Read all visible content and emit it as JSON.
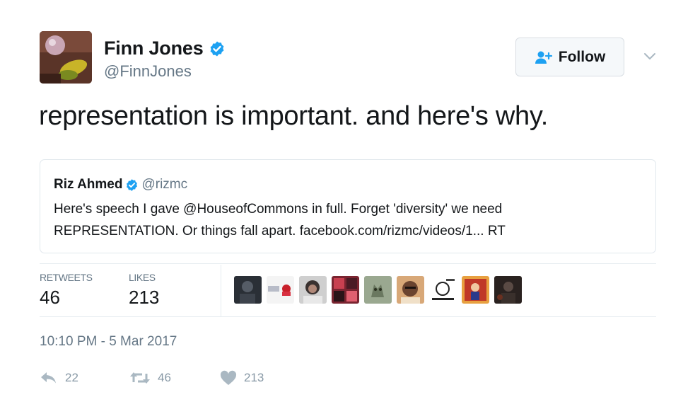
{
  "author": {
    "name": "Finn Jones",
    "handle": "@FinnJones"
  },
  "follow_label": "Follow",
  "tweet_text": "representation is important. and here's why.",
  "quoted_tweet": {
    "name": "Riz Ahmed",
    "handle": "@rizmc",
    "line1": "Here's speech I gave @HouseofCommons in full. Forget 'diversity' we need",
    "line2": "REPRESENTATION. Or things fall apart. facebook.com/rizmc/videos/1... RT"
  },
  "stats": {
    "retweets_label": "RETWEETS",
    "retweets": "46",
    "likes_label": "LIKES",
    "likes": "213"
  },
  "timestamp": "10:10 PM - 5 Mar 2017",
  "actions": {
    "replies": "22",
    "retweets": "46",
    "likes": "213"
  },
  "colors": {
    "verified": "#1da1f2",
    "muted": "#657786",
    "icon": "#aab8c2",
    "follow_icon": "#1da1f2"
  },
  "icons": {
    "verified": "verified-badge-icon",
    "follow": "add-user-icon",
    "caret": "chevron-down-icon",
    "reply": "reply-icon",
    "retweet": "retweet-icon",
    "like": "heart-icon"
  }
}
